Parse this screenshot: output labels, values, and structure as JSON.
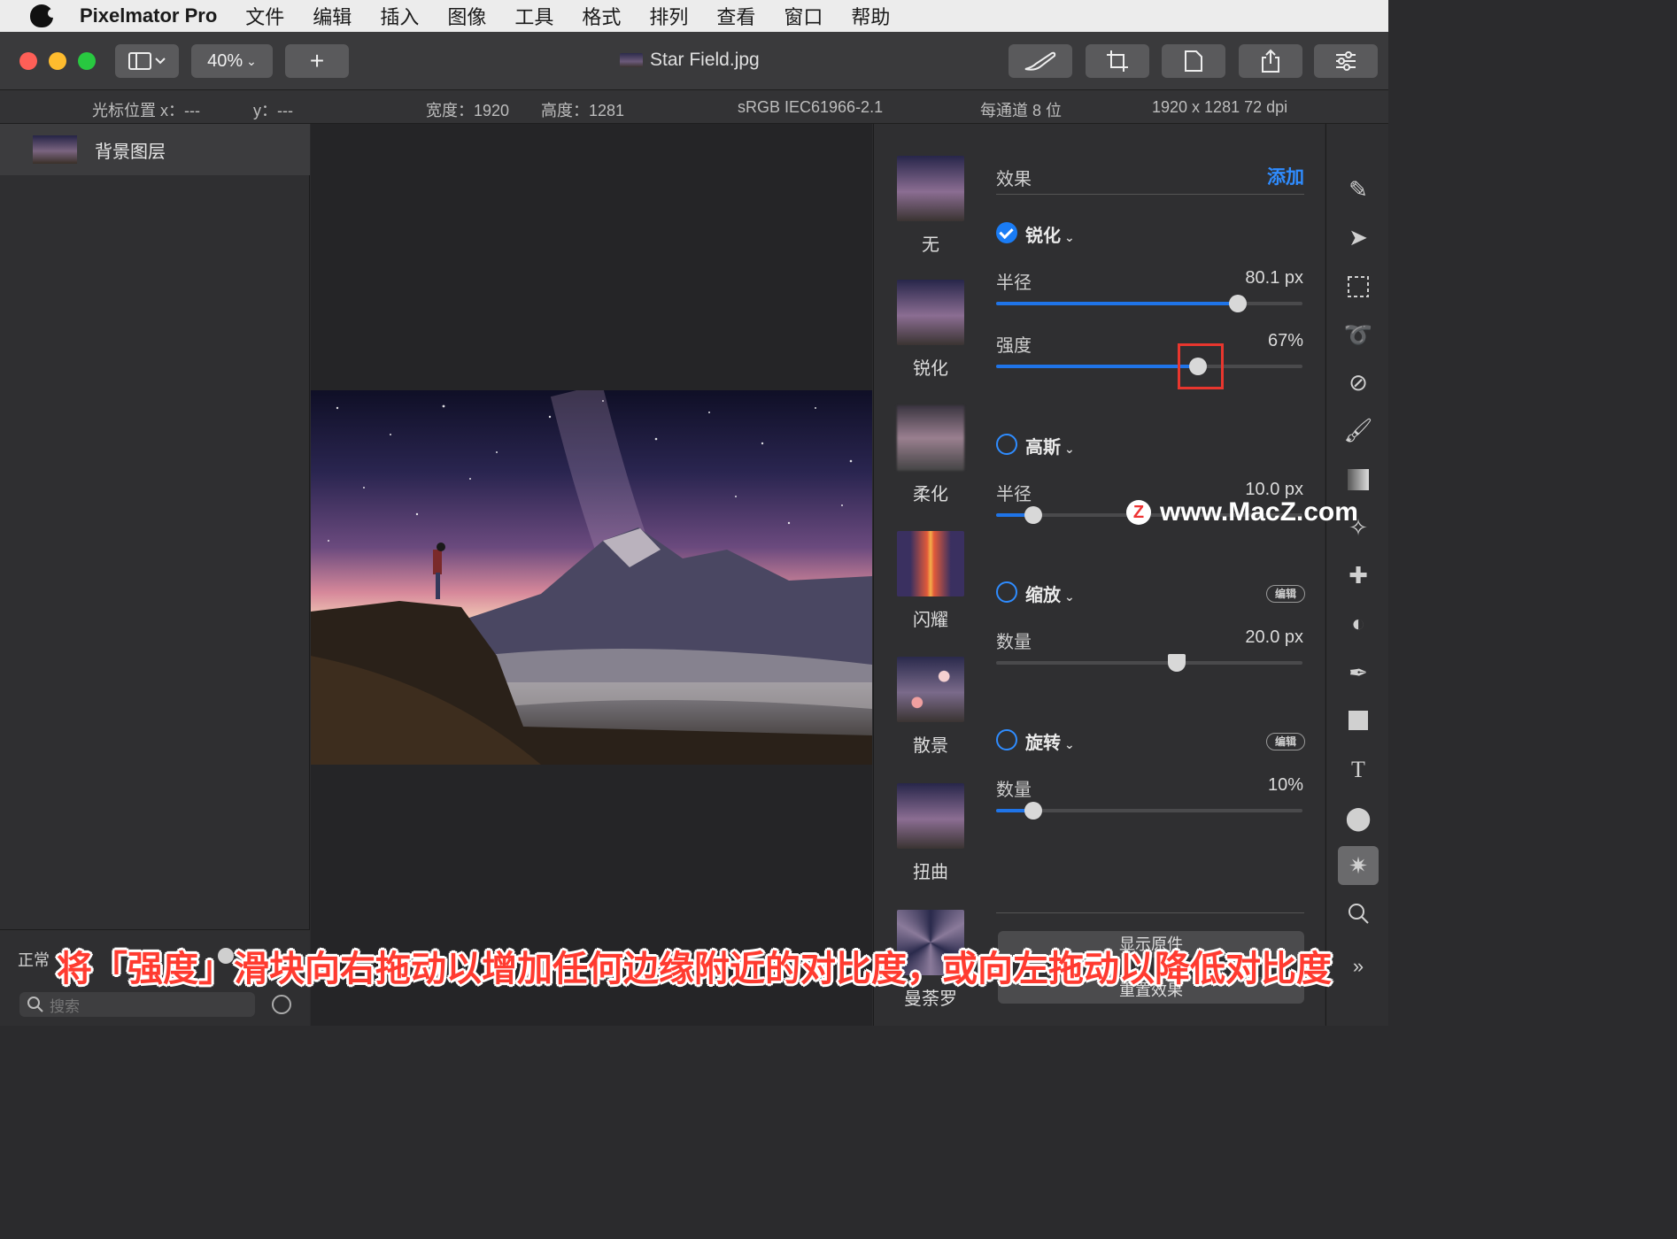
{
  "menu": {
    "app_name": "Pixelmator Pro",
    "items": [
      "文件",
      "编辑",
      "插入",
      "图像",
      "工具",
      "格式",
      "排列",
      "查看",
      "窗口",
      "帮助"
    ]
  },
  "toolbar": {
    "zoom": "40%",
    "add_label": "+",
    "doc_title": "Star Field.jpg"
  },
  "infobar": {
    "cursor_x": "光标位置 x：---",
    "cursor_y": "y：---",
    "width": "宽度：1920",
    "height": "高度：1281",
    "color_profile": "sRGB IEC61966-2.1",
    "bit_depth": "每通道 8 位",
    "resolution": "1920 x 1281 72 dpi"
  },
  "layers": {
    "items": [
      {
        "name": "背景图层"
      }
    ],
    "blend_mode": "正常",
    "search_placeholder": "搜索"
  },
  "presets": [
    {
      "label": "无"
    },
    {
      "label": "锐化"
    },
    {
      "label": "柔化"
    },
    {
      "label": "闪耀"
    },
    {
      "label": "散景"
    },
    {
      "label": "扭曲"
    },
    {
      "label": "曼荼罗"
    }
  ],
  "effects": {
    "title": "效果",
    "add_label": "添加",
    "edit_badge": "编辑",
    "sharpen": {
      "name": "锐化",
      "enabled": true,
      "radius_label": "半径",
      "radius_value": "80.1 px",
      "radius_fraction": 0.79,
      "intensity_label": "强度",
      "intensity_value": "67%",
      "intensity_fraction": 0.66
    },
    "gaussian": {
      "name": "高斯",
      "enabled": false,
      "radius_label": "半径",
      "radius_value": "10.0 px",
      "radius_fraction": 0.12
    },
    "zoom": {
      "name": "缩放",
      "enabled": false,
      "amount_label": "数量",
      "amount_value": "20.0 px",
      "amount_fraction": 0.59
    },
    "spin": {
      "name": "旋转",
      "enabled": false,
      "amount_label": "数量",
      "amount_value": "10%",
      "amount_fraction": 0.12
    },
    "show_original": "显示原件",
    "reset_effects": "重置效果"
  },
  "watermark": "www.MacZ.com",
  "caption": "将「强度」滑块向右拖动以增加任何边缘附近的对比度，或向左拖动以降低对比度",
  "colors": {
    "accent": "#1f74e8",
    "highlight": "#e8362e",
    "caption": "#ff3b30"
  }
}
